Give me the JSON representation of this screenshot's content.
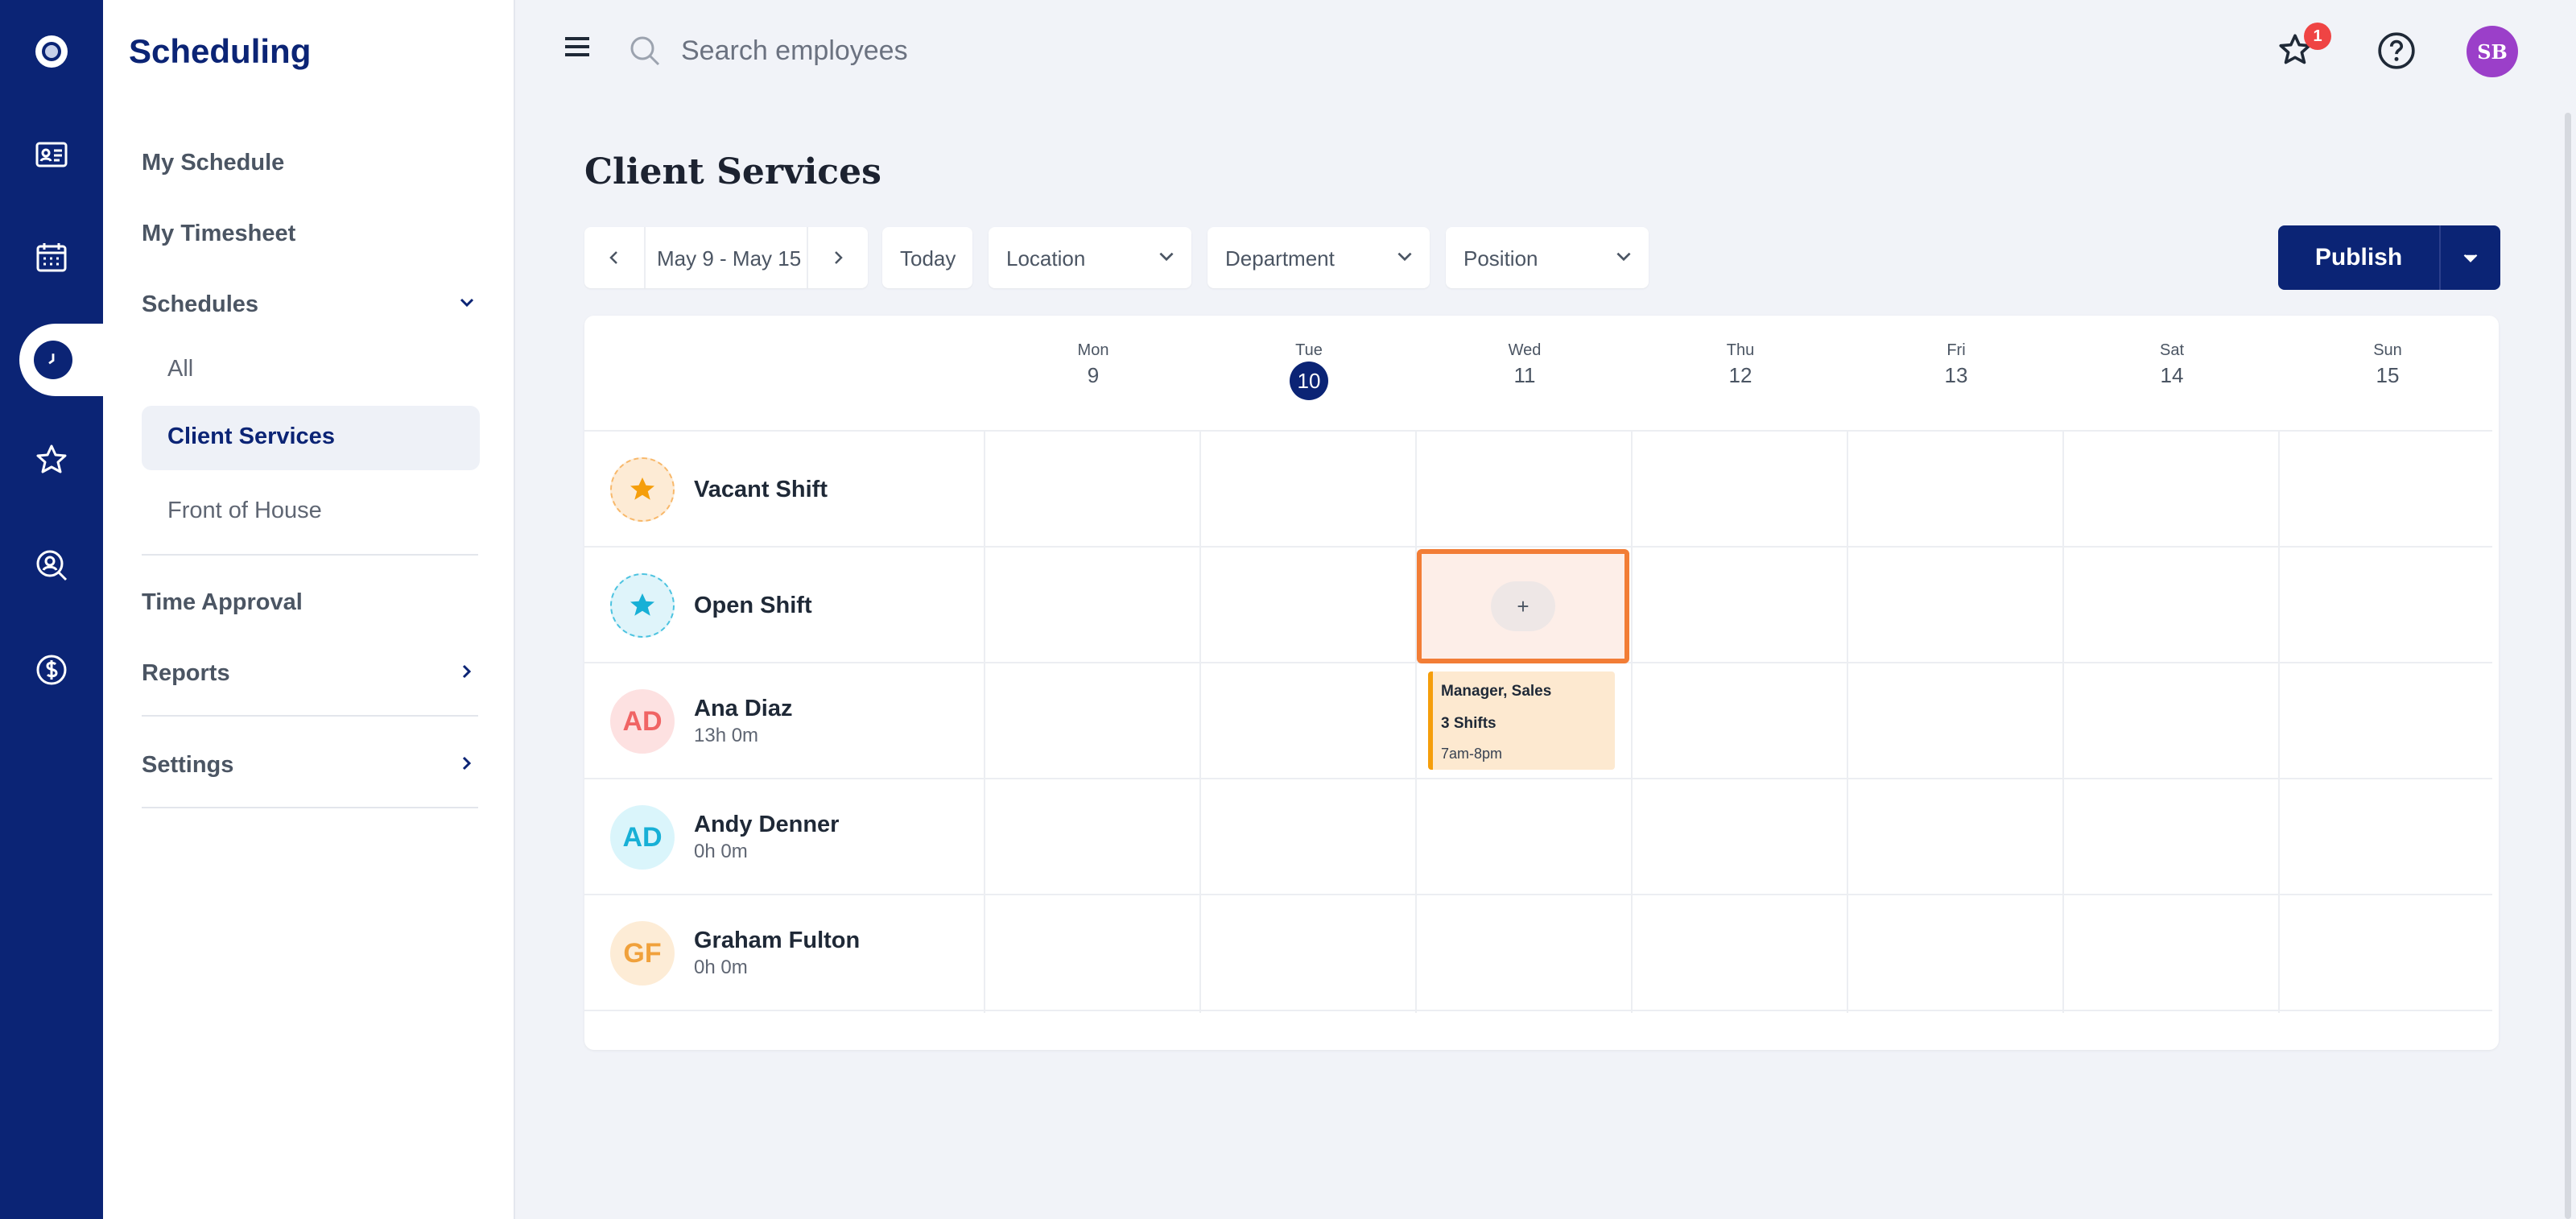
{
  "rail": {
    "items": [
      {
        "icon": "app-logo-icon"
      },
      {
        "icon": "id-card-icon"
      },
      {
        "icon": "calendar-icon"
      },
      {
        "icon": "clock-icon",
        "active": true
      },
      {
        "icon": "star-icon"
      },
      {
        "icon": "search-person-icon"
      },
      {
        "icon": "dollar-icon"
      }
    ]
  },
  "sidebar": {
    "title": "Scheduling",
    "my_schedule": "My Schedule",
    "my_timesheet": "My Timesheet",
    "schedules": "Schedules",
    "schedules_all": "All",
    "schedules_client": "Client Services",
    "schedules_front": "Front of House",
    "time_approval": "Time Approval",
    "reports": "Reports",
    "settings": "Settings"
  },
  "topbar": {
    "search_placeholder": "Search employees",
    "notification_count": "1",
    "user_initials": "SB"
  },
  "page": {
    "title": "Client Services"
  },
  "toolbar": {
    "date_range": "May 9 - May 15",
    "today": "Today",
    "location": "Location",
    "department": "Department",
    "position": "Position",
    "publish": "Publish"
  },
  "week": {
    "days": [
      {
        "name": "Mon",
        "date": "9"
      },
      {
        "name": "Tue",
        "date": "10",
        "today": true
      },
      {
        "name": "Wed",
        "date": "11"
      },
      {
        "name": "Thu",
        "date": "12"
      },
      {
        "name": "Fri",
        "date": "13"
      },
      {
        "name": "Sat",
        "date": "14"
      },
      {
        "name": "Sun",
        "date": "15"
      }
    ]
  },
  "rows": [
    {
      "name": "Vacant Shift",
      "type": "vacant"
    },
    {
      "name": "Open Shift",
      "type": "open"
    },
    {
      "name": "Ana Diaz",
      "initials": "AD",
      "hours": "13h 0m"
    },
    {
      "name": "Andy Denner",
      "initials": "AD",
      "hours": "0h 0m"
    },
    {
      "name": "Graham Fulton",
      "initials": "GF",
      "hours": "0h 0m"
    }
  ],
  "add_cell": {
    "label": "+"
  },
  "shift": {
    "title": "Manager, Sales",
    "count": "3 Shifts",
    "time": "7am-8pm"
  },
  "colors": {
    "brand": "#0b2475",
    "highlight": "#f27d36",
    "shift_bg": "#fde9d0",
    "badge": "#ef4444"
  }
}
